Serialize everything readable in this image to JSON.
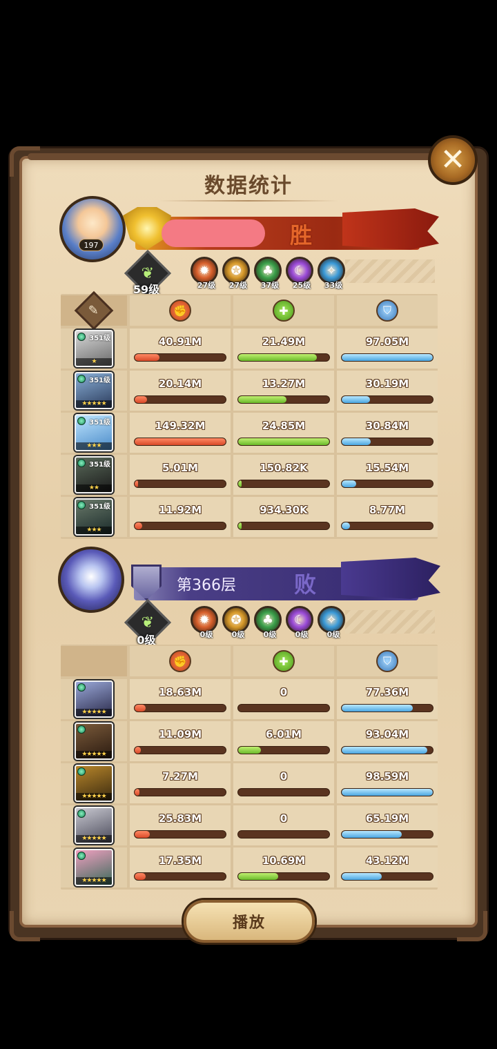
{
  "title": "数据统计",
  "close_icon": "close-icon",
  "player": {
    "avatar_level": "197",
    "result": "胜",
    "tree_level": "59级",
    "factions": [
      {
        "name": "lightbearer",
        "color": "#d8602c",
        "level": "27级"
      },
      {
        "name": "mauler",
        "color": "#d89a2a",
        "level": "27级"
      },
      {
        "name": "wilder",
        "color": "#3aa04a",
        "level": "37级"
      },
      {
        "name": "graveborn",
        "color": "#9a4ad8",
        "level": "25级"
      },
      {
        "name": "celestial",
        "color": "#3a9ad8",
        "level": "33级"
      }
    ],
    "heroes": [
      {
        "level": "351级",
        "stars": "★",
        "damage": "40.91M",
        "damage_pct": 0.27,
        "heal": "21.49M",
        "heal_pct": 0.86,
        "tank": "97.05M",
        "tank_pct": 1.0,
        "colors": [
          "#d8d8d8",
          "#6a6a6a"
        ]
      },
      {
        "level": "351级",
        "stars": "★★★★★",
        "damage": "20.14M",
        "damage_pct": 0.14,
        "heal": "13.27M",
        "heal_pct": 0.53,
        "tank": "30.19M",
        "tank_pct": 0.31,
        "colors": [
          "#8ab0d8",
          "#2a3a5a"
        ]
      },
      {
        "level": "351级",
        "stars": "★★★",
        "damage": "149.32M",
        "damage_pct": 1.0,
        "heal": "24.85M",
        "heal_pct": 1.0,
        "tank": "30.84M",
        "tank_pct": 0.32,
        "colors": [
          "#bfe6ff",
          "#4a8ac8"
        ]
      },
      {
        "level": "351级",
        "stars": "★★",
        "damage": "5.01M",
        "damage_pct": 0.03,
        "heal": "150.82K",
        "heal_pct": 0.01,
        "tank": "15.54M",
        "tank_pct": 0.16,
        "colors": [
          "#5a6a5a",
          "#1a1a1a"
        ]
      },
      {
        "level": "351级",
        "stars": "★★★",
        "damage": "11.92M",
        "damage_pct": 0.08,
        "heal": "934.30K",
        "heal_pct": 0.04,
        "tank": "8.77M",
        "tank_pct": 0.09,
        "colors": [
          "#6a7a6a",
          "#1a2a2a"
        ]
      }
    ]
  },
  "enemy": {
    "floor": "第366层",
    "result": "败",
    "tree_level": "0级",
    "factions": [
      {
        "name": "lightbearer",
        "color": "#d8602c",
        "level": "0级"
      },
      {
        "name": "mauler",
        "color": "#d89a2a",
        "level": "0级"
      },
      {
        "name": "wilder",
        "color": "#3aa04a",
        "level": "0级"
      },
      {
        "name": "graveborn",
        "color": "#9a4ad8",
        "level": "0级"
      },
      {
        "name": "celestial",
        "color": "#3a9ad8",
        "level": "0级"
      }
    ],
    "heroes": [
      {
        "stars": "★★★★★",
        "damage": "18.63M",
        "damage_pct": 0.12,
        "heal": "0",
        "heal_pct": 0.0,
        "tank": "77.36M",
        "tank_pct": 0.78,
        "colors": [
          "#9aa8d8",
          "#2a2a4a"
        ]
      },
      {
        "stars": "★★★★★",
        "damage": "11.09M",
        "damage_pct": 0.07,
        "heal": "6.01M",
        "heal_pct": 0.25,
        "tank": "93.04M",
        "tank_pct": 0.94,
        "colors": [
          "#7a5a3a",
          "#2a1a10"
        ]
      },
      {
        "stars": "★★★★★",
        "damage": "7.27M",
        "damage_pct": 0.05,
        "heal": "0",
        "heal_pct": 0.0,
        "tank": "98.59M",
        "tank_pct": 1.0,
        "colors": [
          "#b8862a",
          "#3a2a10"
        ]
      },
      {
        "stars": "★★★★★",
        "damage": "25.83M",
        "damage_pct": 0.17,
        "heal": "0",
        "heal_pct": 0.0,
        "tank": "65.19M",
        "tank_pct": 0.66,
        "colors": [
          "#c8c8d0",
          "#4a4a5a"
        ]
      },
      {
        "stars": "★★★★★",
        "damage": "17.35M",
        "damage_pct": 0.12,
        "heal": "10.69M",
        "heal_pct": 0.44,
        "tank": "43.12M",
        "tank_pct": 0.44,
        "colors": [
          "#f0a0c0",
          "#3a6a5a"
        ]
      }
    ]
  },
  "play_label": "播放"
}
